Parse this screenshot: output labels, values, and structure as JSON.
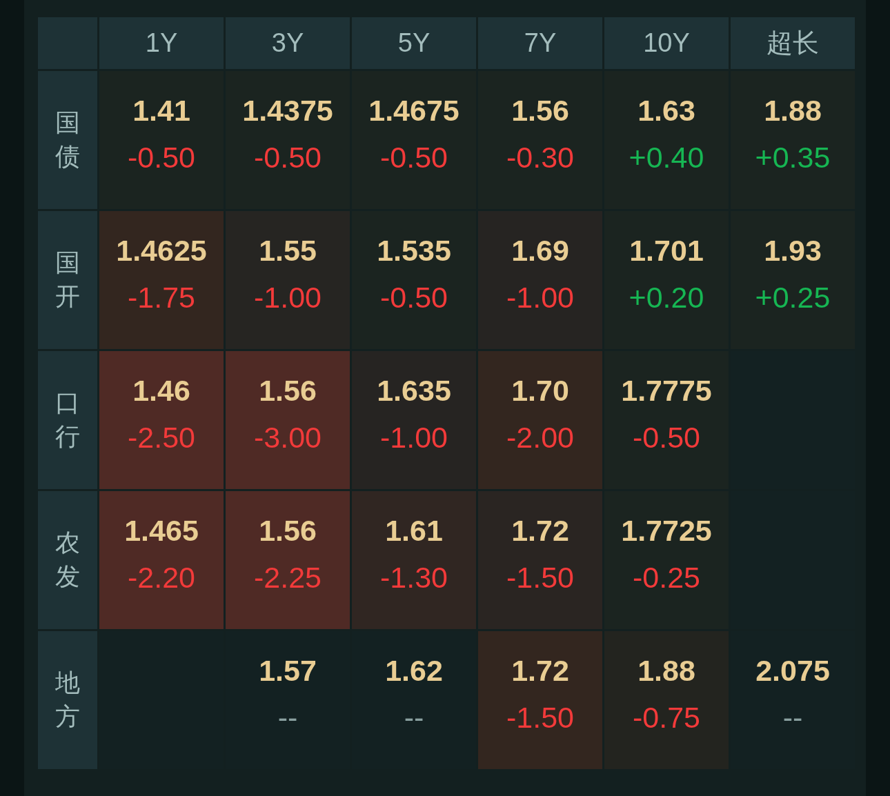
{
  "columns": [
    "1Y",
    "3Y",
    "5Y",
    "7Y",
    "10Y",
    "超长"
  ],
  "rows": [
    {
      "label": "国债",
      "cells": [
        {
          "value": "1.41",
          "change": {
            "text": "-0.50",
            "color": "#f23a3a"
          },
          "color": "#1b2420"
        },
        {
          "value": "1.4375",
          "change": {
            "text": "-0.50",
            "color": "#f23a3a"
          },
          "color": "#1b2420"
        },
        {
          "value": "1.4675",
          "change": {
            "text": "-0.50",
            "color": "#f23a3a"
          },
          "color": "#1b2420"
        },
        {
          "value": "1.56",
          "change": {
            "text": "-0.30",
            "color": "#f23a3a"
          },
          "color": "#1b2420"
        },
        {
          "value": "1.63",
          "change": {
            "text": "+0.40",
            "color": "#16b653"
          },
          "color": "#1b2420"
        },
        {
          "value": "1.88",
          "change": {
            "text": "+0.35",
            "color": "#16b653"
          },
          "color": "#1b2420"
        }
      ]
    },
    {
      "label": "国开",
      "cells": [
        {
          "value": "1.4625",
          "change": {
            "text": "-1.75",
            "color": "#f23a3a"
          },
          "color": "#33261f"
        },
        {
          "value": "1.55",
          "change": {
            "text": "-1.00",
            "color": "#f23a3a"
          },
          "color": "#262522"
        },
        {
          "value": "1.535",
          "change": {
            "text": "-0.50",
            "color": "#f23a3a"
          },
          "color": "#1b2420"
        },
        {
          "value": "1.69",
          "change": {
            "text": "-1.00",
            "color": "#f23a3a"
          },
          "color": "#262422"
        },
        {
          "value": "1.701",
          "change": {
            "text": "+0.20",
            "color": "#16b653"
          },
          "color": "#1b2420"
        },
        {
          "value": "1.93",
          "change": {
            "text": "+0.25",
            "color": "#16b653"
          },
          "color": "#1b2420"
        }
      ]
    },
    {
      "label": "口行",
      "cells": [
        {
          "value": "1.46",
          "change": {
            "text": "-2.50",
            "color": "#f23a3a"
          },
          "color": "#4f2a25"
        },
        {
          "value": "1.56",
          "change": {
            "text": "-3.00",
            "color": "#f23a3a"
          },
          "color": "#4f2a25"
        },
        {
          "value": "1.635",
          "change": {
            "text": "-1.00",
            "color": "#f23a3a"
          },
          "color": "#262422"
        },
        {
          "value": "1.70",
          "change": {
            "text": "-2.00",
            "color": "#f23a3a"
          },
          "color": "#33261f"
        },
        {
          "value": "1.7775",
          "change": {
            "text": "-0.50",
            "color": "#f23a3a"
          },
          "color": "#1b2420"
        },
        null
      ]
    },
    {
      "label": "农发",
      "cells": [
        {
          "value": "1.465",
          "change": {
            "text": "-2.20",
            "color": "#f23a3a"
          },
          "color": "#4f2a25"
        },
        {
          "value": "1.56",
          "change": {
            "text": "-2.25",
            "color": "#f23a3a"
          },
          "color": "#4f2a25"
        },
        {
          "value": "1.61",
          "change": {
            "text": "-1.30",
            "color": "#f23a3a"
          },
          "color": "#302622"
        },
        {
          "value": "1.72",
          "change": {
            "text": "-1.50",
            "color": "#f23a3a"
          },
          "color": "#2a2522"
        },
        {
          "value": "1.7725",
          "change": {
            "text": "-0.25",
            "color": "#f23a3a"
          },
          "color": "#1b2420"
        },
        null
      ]
    },
    {
      "label": "地方",
      "cells": [
        null,
        {
          "value": "1.57",
          "change": {
            "text": "--",
            "color": "#8aa0a0"
          },
          "color": "#132122"
        },
        {
          "value": "1.62",
          "change": {
            "text": "--",
            "color": "#8aa0a0"
          },
          "color": "#132122"
        },
        {
          "value": "1.72",
          "change": {
            "text": "-1.50",
            "color": "#f23a3a"
          },
          "color": "#33261f"
        },
        {
          "value": "1.88",
          "change": {
            "text": "-0.75",
            "color": "#f23a3a"
          },
          "color": "#23241f"
        },
        {
          "value": "2.075",
          "change": {
            "text": "--",
            "color": "#8aa0a0"
          },
          "color": "#132122"
        }
      ]
    }
  ]
}
